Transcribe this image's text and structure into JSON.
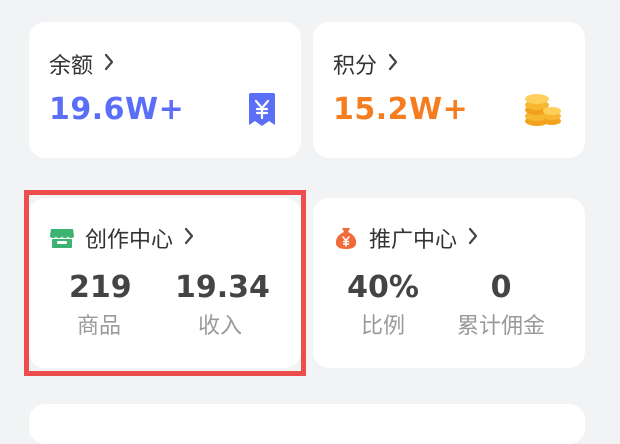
{
  "balance": {
    "title": "余额",
    "value": "19.6W+",
    "icon": "yuan-badge-icon",
    "color": "#5b6ef7"
  },
  "points": {
    "title": "积分",
    "value": "15.2W+",
    "icon": "coins-icon",
    "color": "#f57c1f"
  },
  "creator_center": {
    "title": "创作中心",
    "icon": "store-icon",
    "stats": [
      {
        "value": "219",
        "label": "商品"
      },
      {
        "value": "19.34",
        "label": "收入"
      }
    ]
  },
  "promotion_center": {
    "title": "推广中心",
    "icon": "money-bag-icon",
    "stats": [
      {
        "value": "40%",
        "label": "比例"
      },
      {
        "value": "0",
        "label": "累计佣金"
      }
    ]
  },
  "chevron": "›",
  "highlight_color": "#ec4d4d"
}
